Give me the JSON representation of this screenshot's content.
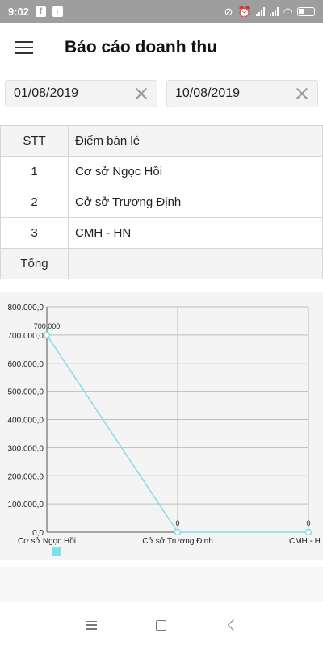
{
  "status_bar": {
    "time": "9:02",
    "left_icons": [
      "facebook-icon",
      "upload-icon"
    ],
    "right_icons": [
      "alarm-off-icon",
      "alarm-icon",
      "signal-icon",
      "signal-icon",
      "wifi-icon",
      "battery-icon"
    ]
  },
  "app_bar": {
    "title": "Báo cáo doanh thu",
    "menu_icon": "hamburger-icon"
  },
  "filters": {
    "from_date": "01/08/2019",
    "to_date": "10/08/2019"
  },
  "table": {
    "headers": [
      "STT",
      "Điểm bán lẻ"
    ],
    "rows": [
      {
        "stt": "1",
        "name": "Cơ sở Ngọc Hồi"
      },
      {
        "stt": "2",
        "name": "Cở sở Trương Định"
      },
      {
        "stt": "3",
        "name": "CMH - HN"
      }
    ],
    "total_label": "Tổng",
    "total_value": ""
  },
  "chart_data": {
    "type": "line",
    "categories": [
      "Cơ sở Ngọc Hồi",
      "Cở sở Trương Định",
      "CMH - HN"
    ],
    "series": [
      {
        "values": [
          700000,
          0,
          0
        ],
        "color": "#80deea"
      }
    ],
    "value_labels": [
      "700,000",
      "0",
      "0"
    ],
    "y_ticks": [
      "0,0",
      "100.000,0",
      "200.000,0",
      "300.000,0",
      "400.000,0",
      "500.000,0",
      "600.000,0",
      "700.000,0",
      "800.000,0"
    ],
    "ylim": [
      0,
      800000
    ],
    "x_tick_labels": [
      "Cơ sở Ngọc Hồi",
      "Cở sở Trương Định",
      "CMH - H"
    ],
    "grid": true,
    "legend": "bottom-left"
  },
  "colors": {
    "accent_line": "#80deea",
    "status_bar": "#9e9e9e"
  },
  "nav_bar": {
    "icons": [
      "recent-apps-icon",
      "home-icon",
      "back-icon"
    ]
  }
}
